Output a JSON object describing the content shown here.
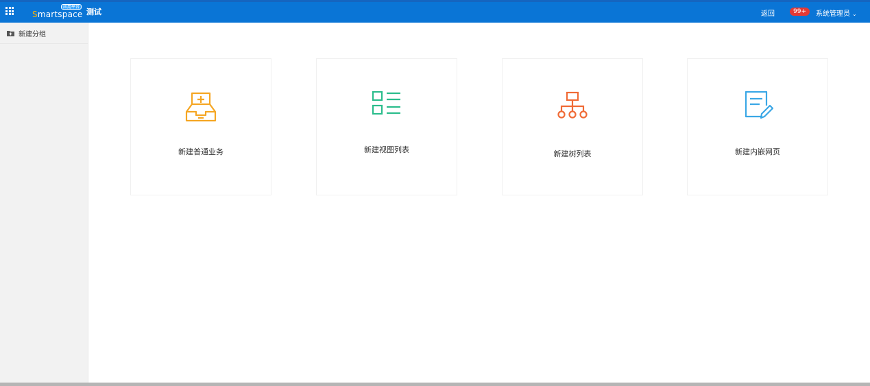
{
  "header": {
    "logo_badge": "应用平台",
    "logo_text": "Smartspace",
    "app_title": "测试",
    "back_label": "返回",
    "notification_count": "99+",
    "user_label": "系统管理员",
    "brand_color": "#0a75d6"
  },
  "sidebar": {
    "items": [
      {
        "label": "新建分组",
        "icon": "folder-add-icon"
      }
    ]
  },
  "cards": [
    {
      "label": "新建普通业务",
      "icon": "inbox-add-icon",
      "color": "#f5a623"
    },
    {
      "label": "新建视图列表",
      "icon": "view-list-icon",
      "color": "#2bbd8c"
    },
    {
      "label": "新建树列表",
      "icon": "tree-icon",
      "color": "#f06a35"
    },
    {
      "label": "新建内嵌网页",
      "icon": "edit-page-icon",
      "color": "#3aa7e6"
    }
  ]
}
